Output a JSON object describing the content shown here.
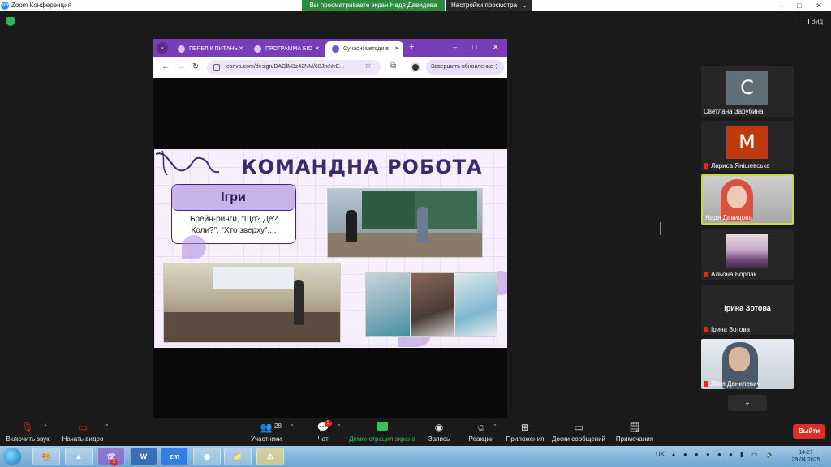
{
  "window": {
    "app_title": "Zoom Конференция",
    "logo_text": "zm",
    "share_banner": "Вы просматриваете экран Надя Давидова",
    "view_settings": "Настройки просмотра",
    "view_button": "Вид"
  },
  "browser": {
    "tabs": [
      {
        "label": "ПЕРЕЛІК ПИТАНЬ"
      },
      {
        "label": "ПРОГРАММА БІО"
      },
      {
        "label": "Сучасні методи в"
      }
    ],
    "url": "canva.com/design/DAGlM3z42NM/68JrxNvE...",
    "update_button": "Завершить обновление"
  },
  "slide": {
    "title": "КОМАНДНА РОБОТА",
    "games_heading": "Ігри",
    "games_text": "Брейн-ринги, “Що? Де? Коли?”, “Хто зверху”...."
  },
  "participants": [
    {
      "name": "Светлана Зарубина",
      "letter": "C",
      "avatar_color": "#5f6f77",
      "muted": false
    },
    {
      "name": "Лариса Янішевська",
      "letter": "M",
      "avatar_color": "#c1390f",
      "muted": true
    },
    {
      "name": "Надя Давидова",
      "muted": false,
      "active": true
    },
    {
      "name": "Альона Борлак",
      "muted": true
    },
    {
      "name": "Ірина Зотова",
      "muted": true
    },
    {
      "name": "Лілія Данилевич",
      "muted": true
    }
  ],
  "toolbar": {
    "audio": "Включить звук",
    "video": "Начать видео",
    "participants": "Участники",
    "participants_count": "28",
    "chat": "Чат",
    "chat_badge": "5",
    "share": "Демонстрация экрана",
    "record": "Запись",
    "reactions": "Реакции",
    "apps": "Приложения",
    "whiteboard": "Доски сообщений",
    "notes": "Примечания",
    "leave": "Выйти"
  },
  "taskbar": {
    "lang": "UK",
    "time": "14:27",
    "date": "29.04.2025",
    "viber_badge": "2",
    "zoom_label": "zm"
  }
}
